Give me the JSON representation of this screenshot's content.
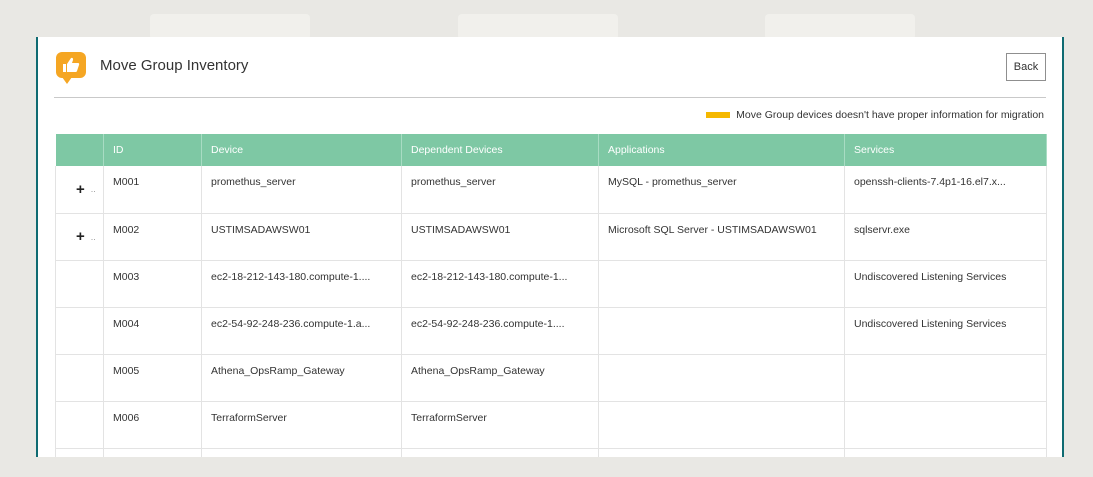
{
  "header": {
    "title": "Move Group Inventory",
    "back_label": "Back",
    "brand_icon": "thumbs-up-icon",
    "brand_color": "#f5a623"
  },
  "legend": {
    "text": "Move Group devices doesn't have proper information for migration",
    "color": "#f5b800"
  },
  "table": {
    "header_color": "#7ec8a4",
    "columns": [
      "ID",
      "Device",
      "Dependent Devices",
      "Applications",
      "Services"
    ],
    "rows": [
      {
        "expand": "+",
        "id": "M001",
        "device": "promethus_server",
        "dependent": "promethus_server",
        "applications": "MySQL - promethus_server",
        "services": "openssh-clients-7.4p1-16.el7.x..."
      },
      {
        "expand": "+",
        "id": "M002",
        "device": "USTIMSADAWSW01",
        "dependent": "USTIMSADAWSW01",
        "applications": "Microsoft SQL Server - USTIMSADAWSW01",
        "services": "sqlservr.exe"
      },
      {
        "expand": "",
        "id": "M003",
        "device": "ec2-18-212-143-180.compute-1....",
        "dependent": "ec2-18-212-143-180.compute-1...",
        "applications": "",
        "services": "Undiscovered Listening Services"
      },
      {
        "expand": "",
        "id": "M004",
        "device": "ec2-54-92-248-236.compute-1.a...",
        "dependent": "ec2-54-92-248-236.compute-1....",
        "applications": "",
        "services": "Undiscovered Listening Services"
      },
      {
        "expand": "",
        "id": "M005",
        "device": "Athena_OpsRamp_Gateway",
        "dependent": "Athena_OpsRamp_Gateway",
        "applications": "",
        "services": ""
      },
      {
        "expand": "",
        "id": "M006",
        "device": "TerraformServer",
        "dependent": "TerraformServer",
        "applications": "",
        "services": ""
      }
    ]
  }
}
